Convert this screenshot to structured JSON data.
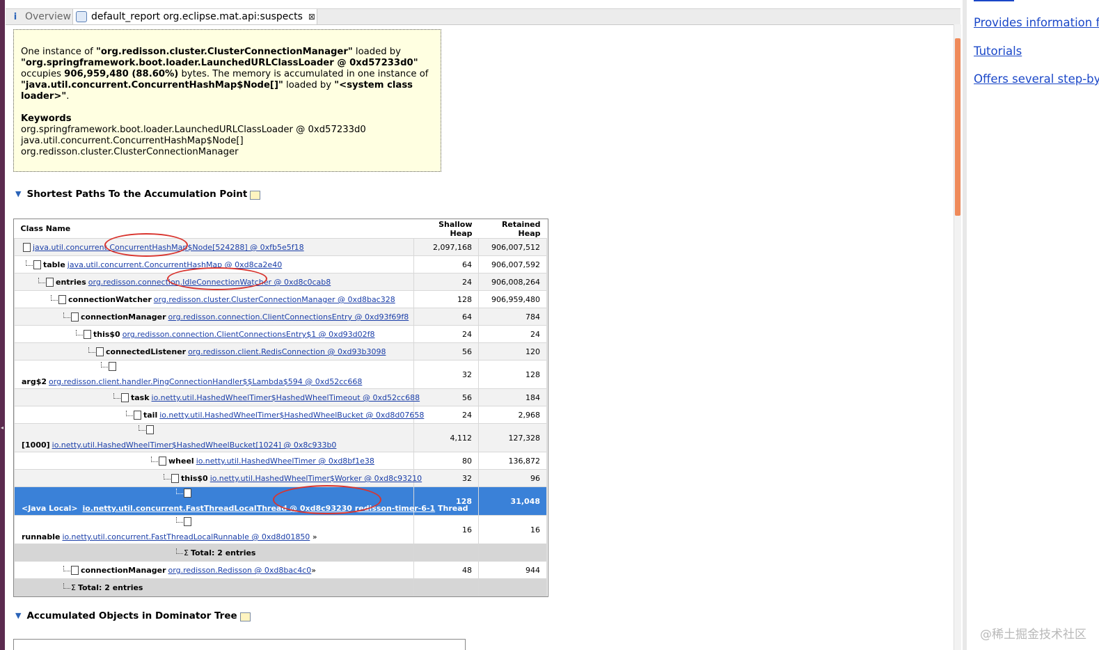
{
  "tabs": {
    "overview_icon": "i",
    "overview": "Overview",
    "report": "default_report  org.eclipse.mat.api:suspects",
    "close": "⊠"
  },
  "summary": {
    "p1_a": "One instance of ",
    "p1_b": "\"org.redisson.cluster.ClusterConnectionManager\"",
    "p1_c": " loaded by ",
    "p1_d": "\"org.springframework.boot.loader.LaunchedURLClassLoader @ 0xd57233d0\"",
    "p1_e": " occupies ",
    "p1_f": "906,959,480 (88.60%)",
    "p1_g": " bytes. The memory is accumulated in one instance of ",
    "p1_h": "\"java.util.concurrent.ConcurrentHashMap$Node[]\"",
    "p1_i": " loaded by ",
    "p1_j": "\"<system class loader>\"",
    "p1_k": ".",
    "keywords_title": "Keywords",
    "keywords": [
      "org.springframework.boot.loader.LaunchedURLClassLoader @ 0xd57233d0",
      "java.util.concurrent.ConcurrentHashMap$Node[]",
      "org.redisson.cluster.ClusterConnectionManager"
    ]
  },
  "sections": {
    "shortest_paths": "Shortest Paths To the Accumulation Point",
    "accumulated": "Accumulated Objects in Dominator Tree"
  },
  "table": {
    "headers": {
      "class_name": "Class Name",
      "shallow": "Shallow Heap",
      "retained": "Retained Heap"
    },
    "rows": [
      {
        "field": "",
        "link": "java.util.concurrent.ConcurrentHashMap$Node[524288] @ 0xfb5e5f18",
        "shallow": "2,097,168",
        "retained": "906,007,512"
      },
      {
        "field": "table",
        "link": "java.util.concurrent.ConcurrentHashMap @ 0xd8ca2e40",
        "shallow": "64",
        "retained": "906,007,592"
      },
      {
        "field": "entries",
        "link": "org.redisson.connection.IdleConnectionWatcher @ 0xd8c0cab8",
        "shallow": "24",
        "retained": "906,008,264"
      },
      {
        "field": "connectionWatcher",
        "link": "org.redisson.cluster.ClusterConnectionManager @ 0xd8bac328",
        "shallow": "128",
        "retained": "906,959,480"
      },
      {
        "field": "connectionManager",
        "link": "org.redisson.connection.ClientConnectionsEntry @ 0xd93f69f8",
        "shallow": "64",
        "retained": "784"
      },
      {
        "field": "this$0",
        "link": "org.redisson.connection.ClientConnectionsEntry$1 @ 0xd93d02f8",
        "shallow": "24",
        "retained": "24"
      },
      {
        "field": "connectedListener",
        "link": "org.redisson.client.RedisConnection @ 0xd93b3098",
        "shallow": "56",
        "retained": "120"
      },
      {
        "field": "arg$2",
        "link": "org.redisson.client.handler.PingConnectionHandler$$Lambda$594 @ 0xd52cc668",
        "shallow": "32",
        "retained": "128"
      },
      {
        "field": "task",
        "link": "io.netty.util.HashedWheelTimer$HashedWheelTimeout @ 0xd52cc688",
        "shallow": "56",
        "retained": "184"
      },
      {
        "field": "tail",
        "link": "io.netty.util.HashedWheelTimer$HashedWheelBucket @ 0xd8d07658",
        "shallow": "24",
        "retained": "2,968"
      },
      {
        "field": "[1000]",
        "link": "io.netty.util.HashedWheelTimer$HashedWheelBucket[1024] @ 0x8c933b0",
        "shallow": "4,112",
        "retained": "127,328"
      },
      {
        "field": "wheel",
        "link": "io.netty.util.HashedWheelTimer @ 0xd8bf1e38",
        "shallow": "80",
        "retained": "136,872"
      },
      {
        "field": "this$0",
        "link": "io.netty.util.HashedWheelTimer$Worker @ 0xd8c93210",
        "shallow": "32",
        "retained": "96"
      },
      {
        "field": "<Java Local>",
        "link": "io.netty.util.concurrent.FastThreadLocalThread @ 0xd8c93230 redisson-timer-6-1",
        "suffix": "Thread",
        "shallow": "128",
        "retained": "31,048"
      },
      {
        "field": "runnable",
        "link": "io.netty.util.concurrent.FastThreadLocalRunnable @ 0xd8d01850",
        "suffix": "»",
        "shallow": "16",
        "retained": "16"
      },
      {
        "total": "Total: 2 entries"
      },
      {
        "field": "connectionManager",
        "link": "org.redisson.Redisson @ 0xd8bac4c0",
        "suffix": "»",
        "shallow": "48",
        "retained": "944"
      },
      {
        "total": "Total: 2 entries"
      }
    ]
  },
  "right_links": [
    "Provides information fo",
    "Tutorials",
    "Offers several step-by-s"
  ],
  "watermark": "@稀土掘金技术社区",
  "colors": {
    "selection": "#3a81d8",
    "summary_bg": "#ffffe1",
    "annotation": "#d9342e",
    "link": "#1a3ea8"
  }
}
